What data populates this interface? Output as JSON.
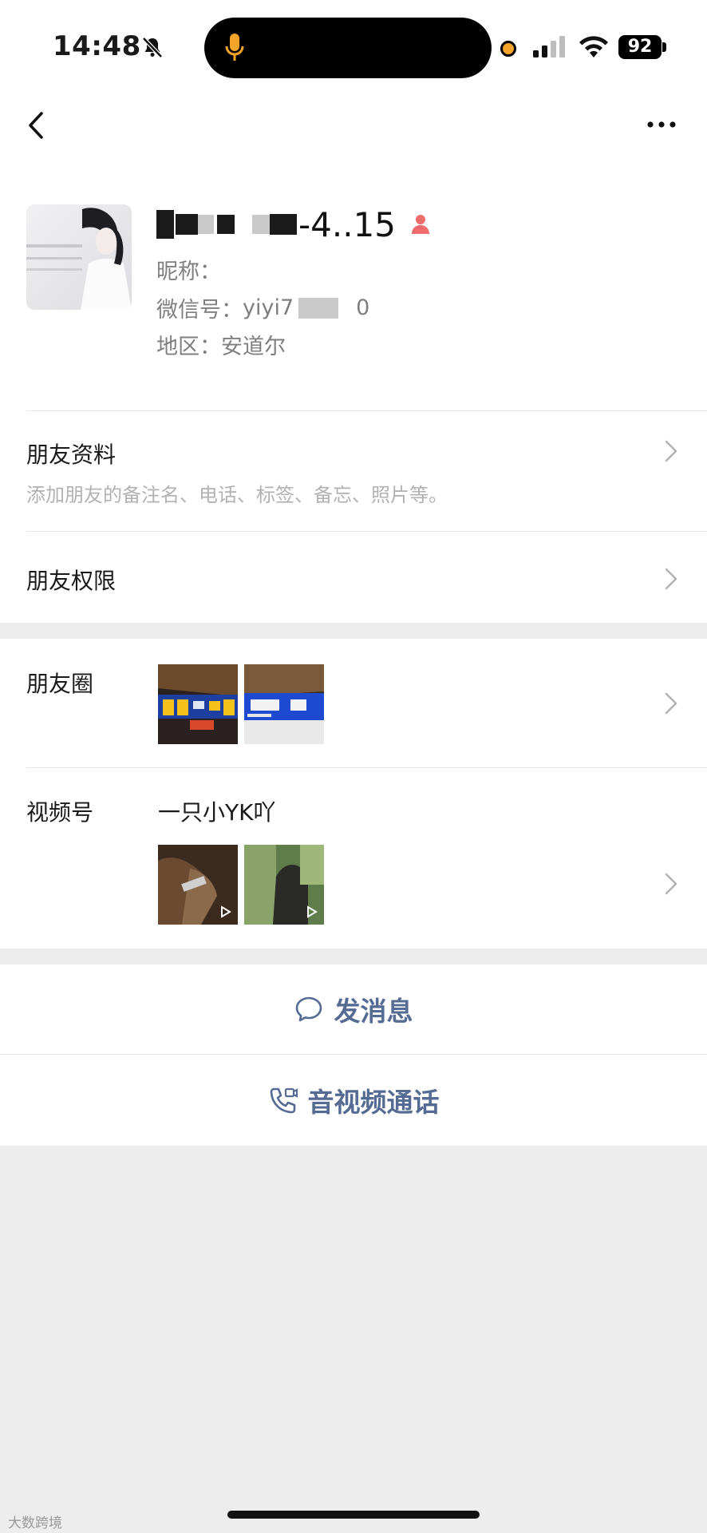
{
  "status_bar": {
    "time": "14:48",
    "battery": "92",
    "icons": [
      "bell-slash-icon",
      "microphone-icon",
      "signal-icon",
      "wifi-icon",
      "battery-icon"
    ]
  },
  "nav": {
    "icons": [
      "chevron-left-icon",
      "more-dots-icon"
    ]
  },
  "profile": {
    "name_suffix": "-4..15",
    "nickname_label": "昵称：",
    "wechat_id_label": "微信号：",
    "wechat_id_prefix": "yiyi7",
    "wechat_id_suffix": "0",
    "region_label": "地区：",
    "region_value": "安道尔",
    "gender_icon": "person-icon",
    "gender_color": "#f06b6b"
  },
  "friend_info": {
    "title": "朋友资料",
    "subtitle": "添加朋友的备注名、电话、标签、备忘、照片等。"
  },
  "friend_permissions": {
    "title": "朋友权限"
  },
  "moments": {
    "title": "朋友圈"
  },
  "channels": {
    "title": "视频号",
    "account_name": "一只小YK吖"
  },
  "actions": {
    "send_message": "发消息",
    "av_call": "音视频通话",
    "color": "#566b94"
  },
  "watermark": "大数跨境"
}
